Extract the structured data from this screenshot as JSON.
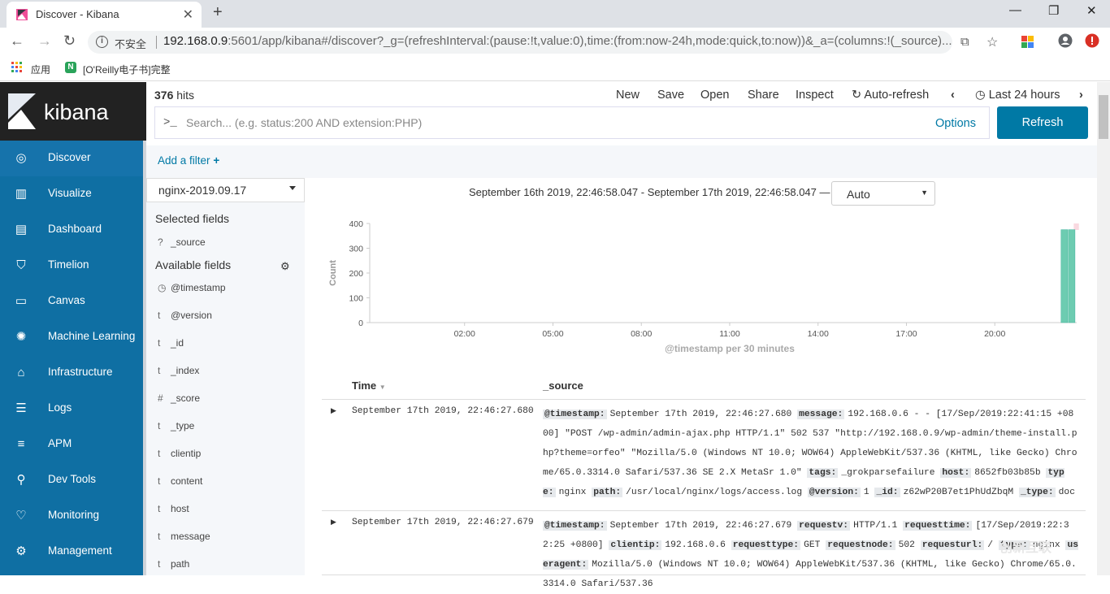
{
  "browser": {
    "tab_title": "Discover - Kibana",
    "insecure_label": "不安全",
    "url_host": "192.168.0.9",
    "url_rest": ":5601/app/kibana#/discover?_g=(refreshInterval:(pause:!t,value:0),time:(from:now-24h,mode:quick,to:now))&_a=(columns:!(_source)...",
    "bookmarks": [
      "应用",
      "[O'Reilly电子书]完整"
    ]
  },
  "kibana": {
    "logo_text": "kibana",
    "nav": [
      {
        "label": "Discover",
        "icon": "compass-icon"
      },
      {
        "label": "Visualize",
        "icon": "chart-icon"
      },
      {
        "label": "Dashboard",
        "icon": "dashboard-icon"
      },
      {
        "label": "Timelion",
        "icon": "shield-icon"
      },
      {
        "label": "Canvas",
        "icon": "canvas-icon"
      },
      {
        "label": "Machine Learning",
        "icon": "ml-icon"
      },
      {
        "label": "Infrastructure",
        "icon": "infrastructure-icon"
      },
      {
        "label": "Logs",
        "icon": "logs-icon"
      },
      {
        "label": "APM",
        "icon": "apm-icon"
      },
      {
        "label": "Dev Tools",
        "icon": "wrench-icon"
      },
      {
        "label": "Monitoring",
        "icon": "heartbeat-icon"
      },
      {
        "label": "Management",
        "icon": "gear-icon"
      }
    ]
  },
  "topbar": {
    "hits_count": "376",
    "hits_label": "hits",
    "new": "New",
    "save": "Save",
    "open": "Open",
    "share": "Share",
    "inspect": "Inspect",
    "auto_refresh": "Auto-refresh",
    "time_range": "Last 24 hours"
  },
  "search": {
    "prompt": ">_",
    "placeholder": "Search... (e.g. status:200 AND extension:PHP)",
    "options": "Options",
    "refresh": "Refresh",
    "add_filter": "Add a filter"
  },
  "fields": {
    "index": "nginx-2019.09.17",
    "selected_heading": "Selected fields",
    "selected": [
      {
        "type": "?",
        "name": "_source"
      }
    ],
    "available_heading": "Available fields",
    "available": [
      {
        "type": "clock",
        "name": "@timestamp"
      },
      {
        "type": "t",
        "name": "@version"
      },
      {
        "type": "t",
        "name": "_id"
      },
      {
        "type": "t",
        "name": "_index"
      },
      {
        "type": "#",
        "name": "_score"
      },
      {
        "type": "t",
        "name": "_type"
      },
      {
        "type": "t",
        "name": "clientip"
      },
      {
        "type": "t",
        "name": "content"
      },
      {
        "type": "t",
        "name": "host"
      },
      {
        "type": "t",
        "name": "message"
      },
      {
        "type": "t",
        "name": "path"
      }
    ]
  },
  "histogram": {
    "range_text": "September 16th 2019, 22:46:58.047 - September 17th 2019, 22:46:58.047 —",
    "interval": "Auto"
  },
  "chart_data": {
    "type": "bar",
    "ylabel": "Count",
    "xlabel": "@timestamp per 30 minutes",
    "ylim": [
      0,
      400
    ],
    "yticks": [
      0,
      100,
      200,
      300,
      400
    ],
    "xticks": [
      "02:00",
      "05:00",
      "08:00",
      "11:00",
      "14:00",
      "17:00",
      "20:00"
    ],
    "x_start_hours": 22.78,
    "x_end_hours": 46.78,
    "tick_hours": [
      26,
      29,
      32,
      35,
      38,
      41,
      44
    ],
    "series": [
      {
        "bars": [
          {
            "x_hours": 46.5,
            "value": 375
          },
          {
            "x_hours": 46.75,
            "value": 375
          }
        ]
      }
    ],
    "bar_color": "#6dccb1"
  },
  "table": {
    "col_time": "Time",
    "col_source": "_source",
    "rows": [
      {
        "time": "September 17th 2019, 22:46:27.680",
        "fields": [
          {
            "k": "@timestamp:",
            "v": "September 17th 2019, 22:46:27.680"
          },
          {
            "k": "message:",
            "v": "192.168.0.6 - - [17/Sep/2019:22:41:15 +0800] \"POST /wp-admin/admin-ajax.php HTTP/1.1\" 502 537 \"http://192.168.0.9/wp-admin/theme-install.php?theme=orfeo\" \"Mozilla/5.0 (Windows NT 10.0; WOW64) AppleWebKit/537.36 (KHTML, like Gecko) Chrome/65.0.3314.0 Safari/537.36 SE 2.X MetaSr 1.0\""
          },
          {
            "k": "tags:",
            "v": "_grokparsefailure"
          },
          {
            "k": "host:",
            "v": "8652fb03b85b"
          },
          {
            "k": "type:",
            "v": "nginx"
          },
          {
            "k": "path:",
            "v": "/usr/local/nginx/logs/access.log"
          },
          {
            "k": "@version:",
            "v": "1"
          },
          {
            "k": "_id:",
            "v": "z62wP20B7et1PhUdZbqM"
          },
          {
            "k": "_type:",
            "v": "doc"
          }
        ]
      },
      {
        "time": "September 17th 2019, 22:46:27.679",
        "fields": [
          {
            "k": "@timestamp:",
            "v": "September 17th 2019, 22:46:27.679"
          },
          {
            "k": "requestv:",
            "v": "HTTP/1.1"
          },
          {
            "k": "requesttime:",
            "v": "[17/Sep/2019:22:32:25 +0800]"
          },
          {
            "k": "clientip:",
            "v": "192.168.0.6"
          },
          {
            "k": "requesttype:",
            "v": "GET"
          },
          {
            "k": "requestnode:",
            "v": "502"
          },
          {
            "k": "requesturl:",
            "v": "/"
          },
          {
            "k": "type:",
            "v": "nginx"
          },
          {
            "k": "useragent:",
            "v": "Mozilla/5.0 (Windows NT 10.0; WOW64) AppleWebKit/537.36 (KHTML, like Gecko) Chrome/65.0.3314.0 Safari/537.36"
          }
        ]
      }
    ]
  }
}
